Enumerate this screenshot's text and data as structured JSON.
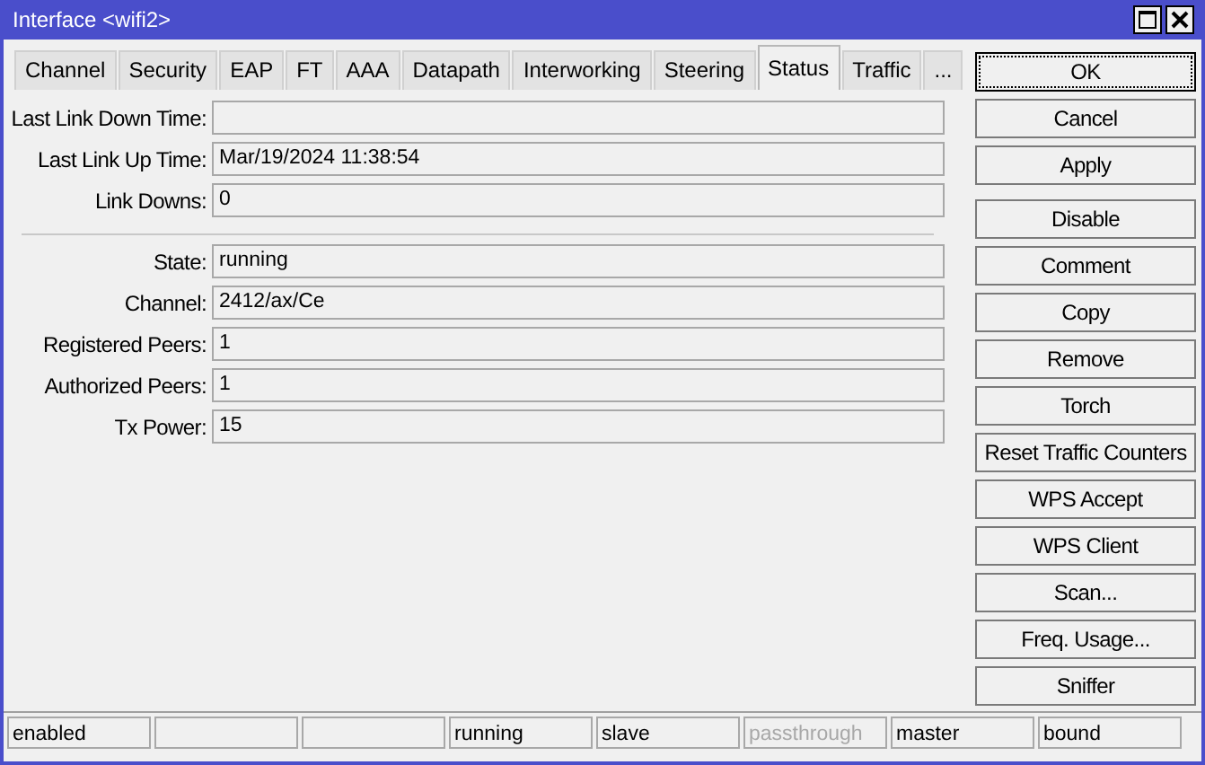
{
  "window": {
    "title": "Interface <wifi2>"
  },
  "tabs": [
    {
      "label": "Channel",
      "selected": false
    },
    {
      "label": "Security",
      "selected": false
    },
    {
      "label": "EAP",
      "selected": false
    },
    {
      "label": "FT",
      "selected": false
    },
    {
      "label": "AAA",
      "selected": false
    },
    {
      "label": "Datapath",
      "selected": false
    },
    {
      "label": "Interworking",
      "selected": false
    },
    {
      "label": "Steering",
      "selected": false
    },
    {
      "label": "Status",
      "selected": true
    },
    {
      "label": "Traffic",
      "selected": false
    },
    {
      "label": "...",
      "selected": false
    }
  ],
  "field_groups": [
    [
      {
        "label": "Last Link Down Time:"
      },
      {
        "label": "Last Link Up Time:",
        "value": "Mar/19/2024 11:38:54"
      },
      {
        "label": "Link Downs:",
        "value": "0"
      }
    ],
    [
      {
        "label": "State:",
        "value": "running"
      },
      {
        "label": "Channel:",
        "value": "2412/ax/Ce"
      },
      {
        "label": "Registered Peers:",
        "value": "1"
      },
      {
        "label": "Authorized Peers:",
        "value": "1"
      },
      {
        "label": "Tx Power:",
        "value": "15"
      }
    ]
  ],
  "button_groups": [
    [
      {
        "label": "OK",
        "focused": true
      },
      {
        "label": "Cancel",
        "focused": false
      },
      {
        "label": "Apply",
        "focused": false
      }
    ],
    [
      {
        "label": "Disable",
        "focused": false
      },
      {
        "label": "Comment",
        "focused": false
      },
      {
        "label": "Copy",
        "focused": false
      },
      {
        "label": "Remove",
        "focused": false
      },
      {
        "label": "Torch",
        "focused": false
      },
      {
        "label": "Reset Traffic Counters",
        "focused": false
      },
      {
        "label": "WPS Accept",
        "focused": false
      },
      {
        "label": "WPS Client",
        "focused": false
      },
      {
        "label": "Scan...",
        "focused": false
      },
      {
        "label": "Freq. Usage...",
        "focused": false
      },
      {
        "label": "Sniffer",
        "focused": false
      }
    ]
  ],
  "status_bar": [
    {
      "kind": "text",
      "text": "enabled",
      "disabled": false
    },
    {
      "kind": "empty"
    },
    {
      "kind": "empty"
    },
    {
      "kind": "text",
      "text": "running",
      "disabled": false
    },
    {
      "kind": "text",
      "text": "slave",
      "disabled": false
    },
    {
      "kind": "text",
      "text": "passthrough",
      "disabled": true
    },
    {
      "kind": "text",
      "text": "master",
      "disabled": false
    },
    {
      "kind": "text",
      "text": "bound",
      "disabled": false
    }
  ]
}
